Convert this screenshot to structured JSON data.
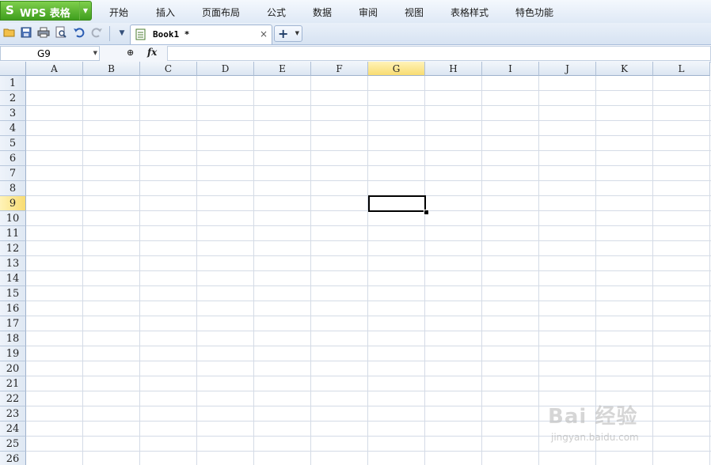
{
  "app": {
    "logo_glyph": "S",
    "title": "WPS 表格",
    "dropdown_glyph": "▼"
  },
  "menu": [
    "开始",
    "插入",
    "页面布局",
    "公式",
    "数据",
    "审阅",
    "视图",
    "表格样式",
    "特色功能"
  ],
  "toolbar": {
    "icons": [
      "open-folder-icon",
      "save-icon",
      "print-icon",
      "print-preview-icon",
      "undo-icon",
      "redo-icon",
      "customize-dropdown-icon"
    ],
    "doc_tab": {
      "label": "Book1 *",
      "close_glyph": "×"
    },
    "new_tab": {
      "plus_glyph": "+",
      "dropdown_glyph": "▼"
    }
  },
  "formula_bar": {
    "cell_reference": "G9",
    "dropdown_glyph": "▼",
    "zoom_glyph": "⊕",
    "fx_label": "fx",
    "formula_value": ""
  },
  "sheet": {
    "columns": [
      "A",
      "B",
      "C",
      "D",
      "E",
      "F",
      "G",
      "H",
      "I",
      "J",
      "K",
      "L"
    ],
    "rows": [
      "1",
      "2",
      "3",
      "4",
      "5",
      "6",
      "7",
      "8",
      "9",
      "10",
      "11",
      "12",
      "13",
      "14",
      "15",
      "16",
      "17",
      "18",
      "19",
      "20",
      "21",
      "22",
      "23",
      "24",
      "25",
      "26"
    ],
    "selected_column": "G",
    "selected_row": "9"
  },
  "watermark": {
    "text": "Bai 经验",
    "url_text": "jingyan.baidu.com"
  },
  "colors": {
    "accent_green": "#3f9e1e",
    "header_blue": "#dce6f2",
    "selected_header": "#f8dc72"
  }
}
